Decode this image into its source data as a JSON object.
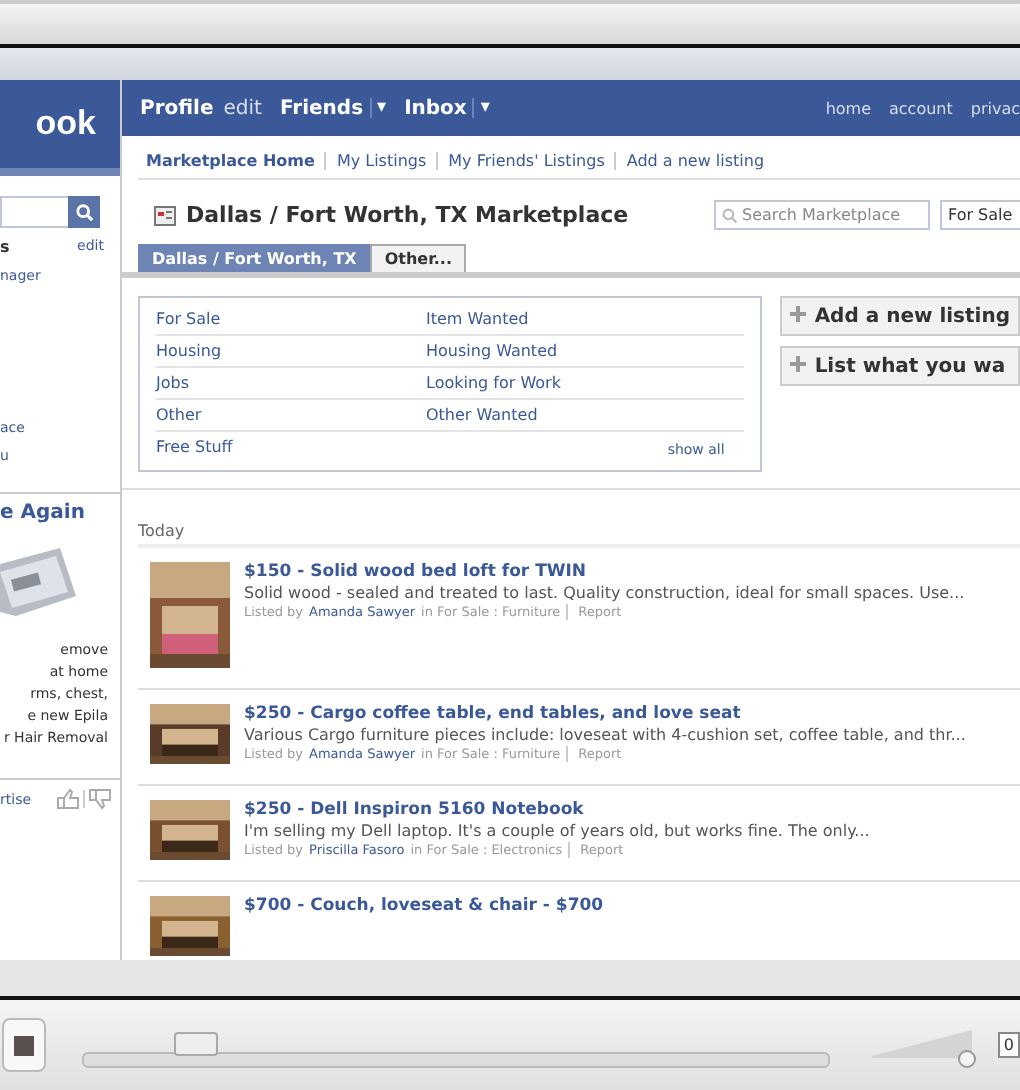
{
  "sidebar": {
    "logo": "ook",
    "heading": "s",
    "heading_link": "edit",
    "items": [
      "nager",
      "ace",
      "u"
    ],
    "ad": {
      "title": "e Again",
      "lines": [
        "emove",
        "at home",
        "rms, chest,",
        "e new Epila",
        "r Hair Removal"
      ]
    },
    "footer_link": "rtise"
  },
  "top_nav": {
    "left": [
      {
        "label": "Profile",
        "bold": true,
        "menu": false
      },
      {
        "label": "edit",
        "bold": false,
        "menu": false
      },
      {
        "label": "Friends",
        "bold": true,
        "menu": true
      },
      {
        "label": "Inbox",
        "bold": true,
        "menu": true
      }
    ],
    "menu_glyph": "▾",
    "right": [
      "home",
      "account",
      "privac"
    ]
  },
  "sub_nav": [
    {
      "label": "Marketplace Home",
      "selected": true
    },
    {
      "label": "My Listings",
      "selected": false
    },
    {
      "label": "My Friends' Listings",
      "selected": false
    },
    {
      "label": "Add a new listing",
      "selected": false
    }
  ],
  "page_title": "Dallas / Fort Worth, TX Marketplace",
  "search": {
    "placeholder": "Search Marketplace",
    "filter": "For Sale"
  },
  "tabs": [
    {
      "label": "Dallas / Fort Worth, TX",
      "selected": true
    },
    {
      "label": "Other...",
      "selected": false
    }
  ],
  "categories": [
    [
      "For Sale",
      "Item Wanted"
    ],
    [
      "Housing",
      "Housing Wanted"
    ],
    [
      "Jobs",
      "Looking for Work"
    ],
    [
      "Other",
      "Other Wanted"
    ],
    [
      "Free Stuff"
    ]
  ],
  "show_all": "show all",
  "actions": [
    "Add a new listing",
    "List what you wa"
  ],
  "section": "Today",
  "listings": [
    {
      "title": "$150 - Solid wood bed loft for TWIN",
      "description": "Solid wood - sealed and treated to last. Quality construction, ideal for small spaces. Use...",
      "listed_by": "Listed by",
      "author": "Amanda Sawyer",
      "category": "in For Sale : Furniture",
      "report": "Report"
    },
    {
      "title": "$250 - Cargo coffee table, end tables, and love seat",
      "description": "Various Cargo furniture pieces include: loveseat with 4-cushion set, coffee table, and thr...",
      "listed_by": "Listed by",
      "author": "Amanda Sawyer",
      "category": "in For Sale : Furniture",
      "report": "Report"
    },
    {
      "title": "$250 - Dell Inspiron 5160 Notebook",
      "description": "I'm selling my Dell laptop. It's a couple of years old, but works fine. The only...",
      "listed_by": "Listed by",
      "author": "Priscilla Fasoro",
      "category": "in For Sale : Electronics",
      "report": "Report"
    },
    {
      "title": "$700 - Couch, loveseat & chair - $700"
    }
  ],
  "player": {
    "seek": {
      "level": 0.15
    },
    "volume": {
      "level": 0.97
    },
    "time": "0"
  }
}
